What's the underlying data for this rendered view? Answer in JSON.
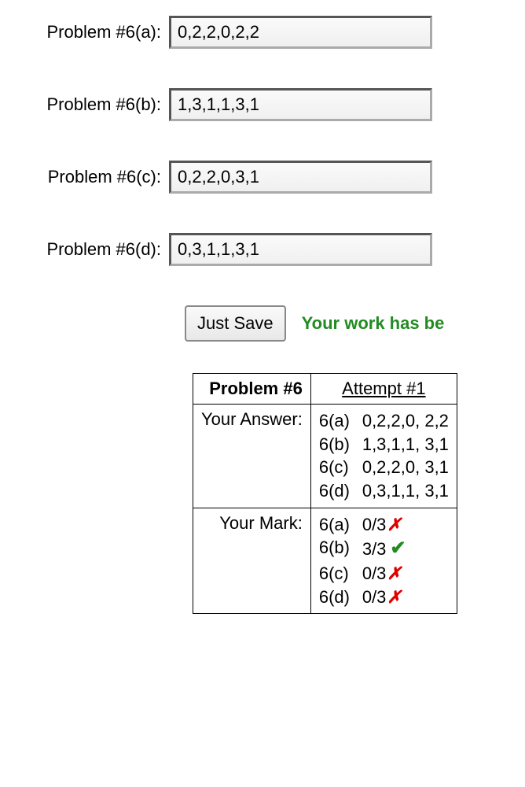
{
  "problems": [
    {
      "label": "Problem #6(a):",
      "value": "0,2,2,0,2,2"
    },
    {
      "label": "Problem #6(b):",
      "value": "1,3,1,1,3,1"
    },
    {
      "label": "Problem #6(c):",
      "value": "0,2,2,0,3,1"
    },
    {
      "label": "Problem #6(d):",
      "value": "0,3,1,1,3,1"
    }
  ],
  "save_button": "Just Save",
  "save_message": "Your work has be",
  "results": {
    "header_left": "Problem #6",
    "header_right": "Attempt #1",
    "your_answer_label": "Your Answer:",
    "your_mark_label": "Your Mark:",
    "answers": [
      {
        "part": "6(a)",
        "value": "0,2,2,0, 2,2"
      },
      {
        "part": "6(b)",
        "value": "1,3,1,1, 3,1"
      },
      {
        "part": "6(c)",
        "value": "0,2,2,0, 3,1"
      },
      {
        "part": "6(d)",
        "value": "0,3,1,1, 3,1"
      }
    ],
    "marks": [
      {
        "part": "6(a)",
        "score": "0/3",
        "correct": false
      },
      {
        "part": "6(b)",
        "score": "3/3",
        "correct": true
      },
      {
        "part": "6(c)",
        "score": "0/3",
        "correct": false
      },
      {
        "part": "6(d)",
        "score": "0/3",
        "correct": false
      }
    ]
  }
}
